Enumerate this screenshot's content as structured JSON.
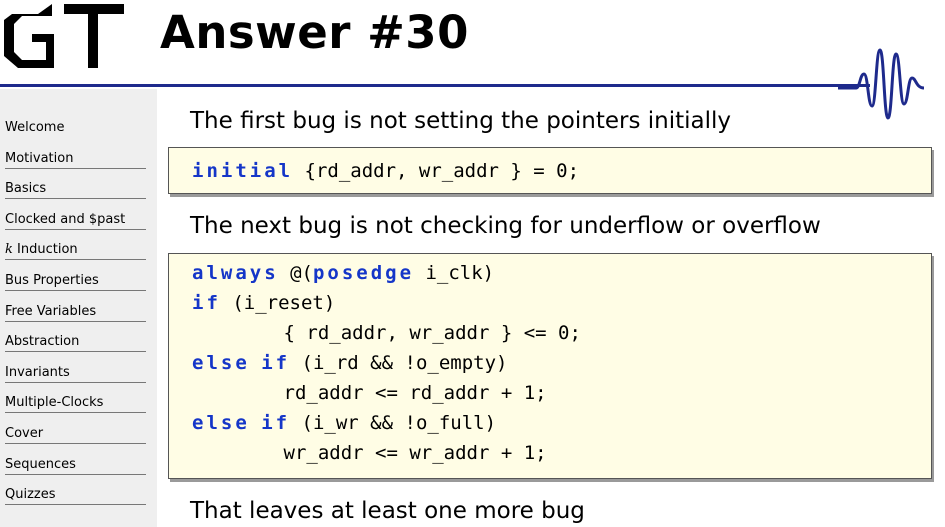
{
  "header": {
    "logo_text": "GT",
    "title": "Answer #30",
    "accent_color": "#1e2a8c"
  },
  "sidebar": {
    "items": [
      {
        "label": "Welcome",
        "ruled": false
      },
      {
        "label": "Motivation",
        "ruled": true
      },
      {
        "label": "Basics",
        "ruled": true
      },
      {
        "label": "Clocked and $past",
        "ruled": true
      },
      {
        "label": "Induction",
        "prefix": "k",
        "ruled": true
      },
      {
        "label": "Bus Properties",
        "ruled": true
      },
      {
        "label": "Free Variables",
        "ruled": true
      },
      {
        "label": "Abstraction",
        "ruled": true
      },
      {
        "label": "Invariants",
        "ruled": true
      },
      {
        "label": "Multiple-Clocks",
        "ruled": true
      },
      {
        "label": "Cover",
        "ruled": true
      },
      {
        "label": "Sequences",
        "ruled": true
      },
      {
        "label": "Quizzes",
        "ruled": true
      }
    ]
  },
  "main": {
    "para1": "The first bug is not setting the pointers initially",
    "code1": {
      "lines": [
        [
          {
            "t": "initial",
            "kw": true
          },
          {
            "t": " {rd_addr, wr_addr } = 0;"
          }
        ]
      ]
    },
    "para2": "The next bug is not checking for underflow or overflow",
    "code2": {
      "lines": [
        [
          {
            "t": "always",
            "kw": true
          },
          {
            "t": " @("
          },
          {
            "t": "posedge",
            "kw": true
          },
          {
            "t": " i_clk)"
          }
        ],
        [
          {
            "t": "if",
            "kw": true
          },
          {
            "t": " (i_reset)"
          }
        ],
        [
          {
            "t": "        { rd_addr, wr_addr } <= 0;"
          }
        ],
        [
          {
            "t": "else",
            "kw": true
          },
          {
            "t": " "
          },
          {
            "t": "if",
            "kw": true
          },
          {
            "t": " (i_rd && !o_empty)"
          }
        ],
        [
          {
            "t": "        rd_addr <= rd_addr + 1;"
          }
        ],
        [
          {
            "t": "else",
            "kw": true
          },
          {
            "t": " "
          },
          {
            "t": "if",
            "kw": true
          },
          {
            "t": " (i_wr && !o_full)"
          }
        ],
        [
          {
            "t": "        wr_addr <= wr_addr + 1;"
          }
        ]
      ]
    },
    "para3": "That leaves at least one more bug",
    "code_bg_color": "#fffde5",
    "keyword_color": "#1536c8"
  }
}
